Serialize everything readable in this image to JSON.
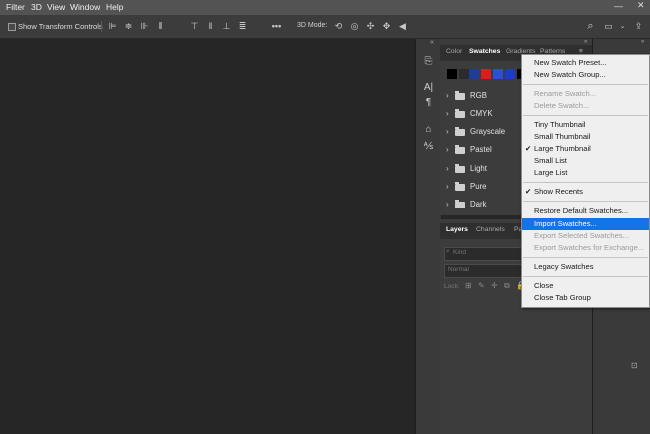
{
  "menubar": {
    "items": [
      "Filter",
      "3D",
      "View",
      "Window",
      "Help"
    ]
  },
  "options_bar": {
    "transform_label": "Show Transform Controls",
    "mode_label": "3D Mode:"
  },
  "swatches_panel": {
    "tabs": [
      "Color",
      "Swatches",
      "Gradients",
      "Patterns"
    ],
    "colors": [
      "#000000",
      "#2b2b2b",
      "#1f3c9a",
      "#e01b1b",
      "#2b4fd8",
      "#1a3ad0",
      "#000000"
    ],
    "folders": [
      "RGB",
      "CMYK",
      "Grayscale",
      "Pastel",
      "Light",
      "Pure",
      "Dark"
    ]
  },
  "layers_panel": {
    "tabs": [
      "Layers",
      "Channels",
      "Pa"
    ],
    "kind_placeholder": "Kind",
    "blend_mode": "Normal",
    "lock_label": "Lock:"
  },
  "context_menu": {
    "group1": [
      {
        "label": "New Swatch Preset...",
        "disabled": false
      },
      {
        "label": "New Swatch Group...",
        "disabled": false
      }
    ],
    "group2": [
      {
        "label": "Rename Swatch...",
        "disabled": true
      },
      {
        "label": "Delete Swatch...",
        "disabled": true
      }
    ],
    "group3": [
      {
        "label": "Tiny Thumbnail",
        "checked": false
      },
      {
        "label": "Small Thumbnail",
        "checked": false
      },
      {
        "label": "Large Thumbnail",
        "checked": true
      },
      {
        "label": "Small List",
        "checked": false
      },
      {
        "label": "Large List",
        "checked": false
      }
    ],
    "group4": [
      {
        "label": "Show Recents",
        "checked": true
      }
    ],
    "group5": [
      {
        "label": "Restore Default Swatches...",
        "disabled": false,
        "highlighted": false
      },
      {
        "label": "Import Swatches...",
        "disabled": false,
        "highlighted": true
      },
      {
        "label": "Export Selected Swatches...",
        "disabled": true,
        "highlighted": false
      },
      {
        "label": "Export Swatches for Exchange...",
        "disabled": true,
        "highlighted": false
      }
    ],
    "group6": [
      {
        "label": "Legacy Swatches"
      }
    ],
    "group7": [
      {
        "label": "Close"
      },
      {
        "label": "Close Tab Group"
      }
    ]
  },
  "colors": {
    "highlight": "#1473e6",
    "menu_bg": "#efefef",
    "panel_bg": "#3c3c3c"
  }
}
